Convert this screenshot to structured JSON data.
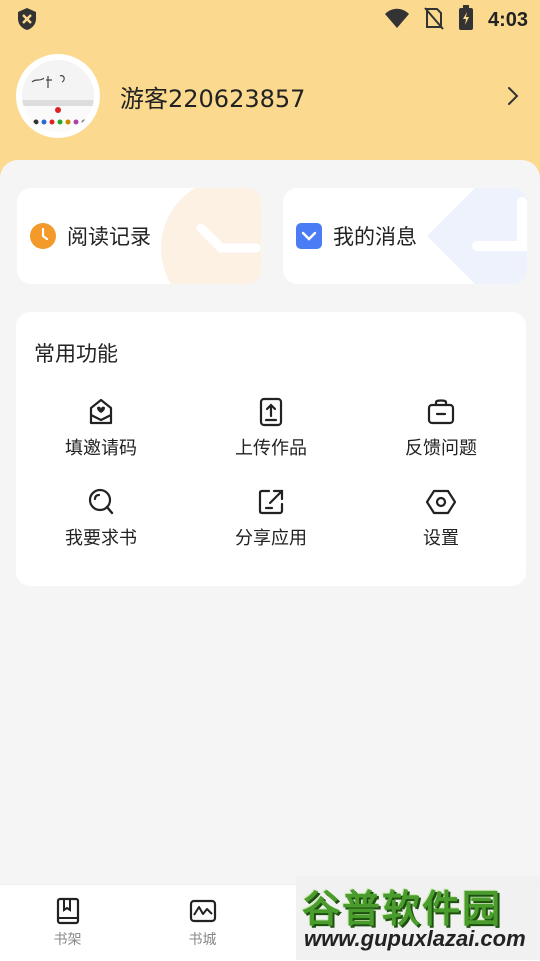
{
  "status_bar": {
    "time": "4:03"
  },
  "profile": {
    "username": "游客220623857"
  },
  "quick_actions": [
    {
      "label": "阅读记录",
      "icon": "clock-icon"
    },
    {
      "label": "我的消息",
      "icon": "chevron-down-icon"
    }
  ],
  "functions": {
    "title": "常用功能",
    "items": [
      {
        "label": "填邀请码",
        "icon": "envelope-icon"
      },
      {
        "label": "上传作品",
        "icon": "upload-icon"
      },
      {
        "label": "反馈问题",
        "icon": "feedback-icon"
      },
      {
        "label": "我要求书",
        "icon": "request-book-icon"
      },
      {
        "label": "分享应用",
        "icon": "share-icon"
      },
      {
        "label": "设置",
        "icon": "settings-icon"
      }
    ]
  },
  "bottom_nav": [
    {
      "label": "书架",
      "icon": "bookshelf-icon"
    },
    {
      "label": "书城",
      "icon": "bookstore-icon"
    }
  ],
  "watermark": {
    "title": "谷普软件园",
    "url": "www.gupuxlazai.com"
  },
  "colors": {
    "header": "#fbd98e",
    "clock_orange": "#f39a2a",
    "message_blue": "#4a7df5",
    "background": "#f5f5f5"
  }
}
